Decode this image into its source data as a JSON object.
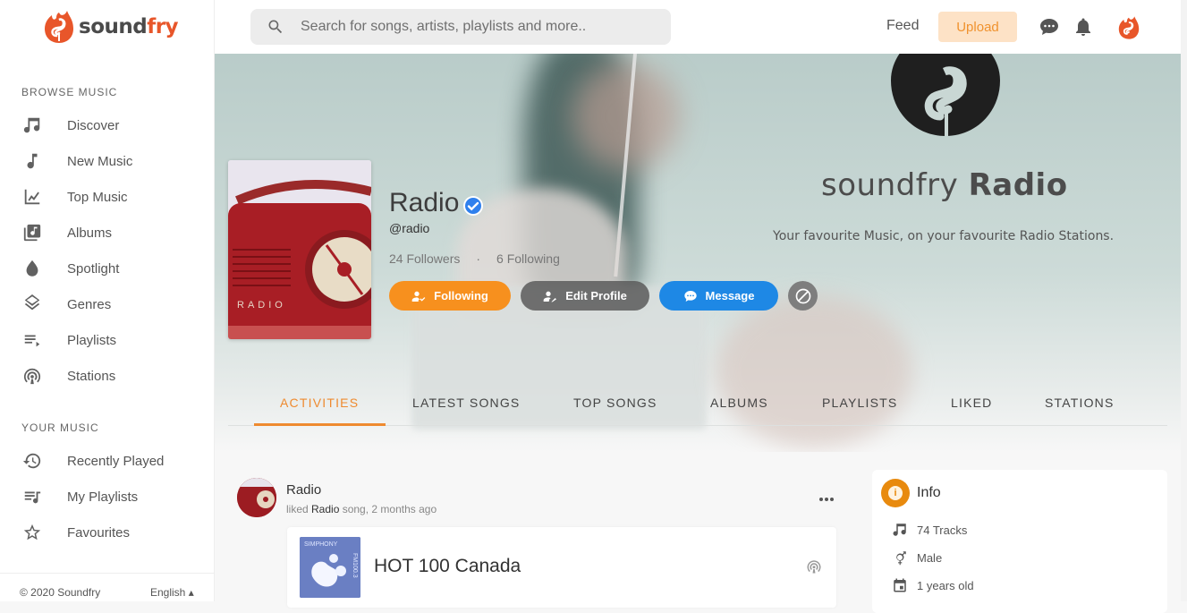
{
  "app": {
    "brand_prefix": "sound",
    "brand_suffix": "fry",
    "brand_color": "#e8562a"
  },
  "sidebar": {
    "browse_title": "BROWSE MUSIC",
    "browse_items": [
      {
        "label": "Discover",
        "icon": "music-notes-icon"
      },
      {
        "label": "New Music",
        "icon": "music-note-icon"
      },
      {
        "label": "Top Music",
        "icon": "trending-chart-icon"
      },
      {
        "label": "Albums",
        "icon": "album-library-icon"
      },
      {
        "label": "Spotlight",
        "icon": "drop-icon"
      },
      {
        "label": "Genres",
        "icon": "layers-icon"
      },
      {
        "label": "Playlists",
        "icon": "playlist-play-icon"
      },
      {
        "label": "Stations",
        "icon": "podcast-antenna-icon"
      }
    ],
    "your_title": "YOUR MUSIC",
    "your_items": [
      {
        "label": "Recently Played",
        "icon": "history-icon"
      },
      {
        "label": "My Playlists",
        "icon": "queue-music-icon"
      },
      {
        "label": "Favourites",
        "icon": "star-outline-icon"
      }
    ],
    "footer": {
      "copyright": "© 2020 Soundfry",
      "language": "English ▴"
    }
  },
  "header": {
    "search_placeholder": "Search for songs, artists, playlists and more..",
    "search_value": "",
    "feed_label": "Feed",
    "upload_label": "Upload",
    "upload_color": "#f0922e"
  },
  "banner": {
    "title_light": "soundfry ",
    "title_bold": "Radio",
    "subtitle": "Your favourite Music, on your favourite Radio Stations."
  },
  "profile": {
    "name": "Radio",
    "verified": true,
    "handle": "@radio",
    "followers": "24 Followers",
    "separator": "·",
    "following": "6 Following",
    "cover_text": "RADIO",
    "buttons": {
      "following": "Following",
      "edit": "Edit Profile",
      "message": "Message"
    },
    "colors": {
      "following": "#f7901e",
      "message": "#1e88e5",
      "verified": "#1e88e5"
    }
  },
  "tabs": [
    {
      "label": "ACTIVITIES",
      "active": true
    },
    {
      "label": "LATEST SONGS",
      "active": false
    },
    {
      "label": "TOP SONGS",
      "active": false
    },
    {
      "label": "ALBUMS",
      "active": false
    },
    {
      "label": "PLAYLISTS",
      "active": false
    },
    {
      "label": "LIKED",
      "active": false
    },
    {
      "label": "STATIONS",
      "active": false
    }
  ],
  "activity": {
    "user": "Radio",
    "action_prefix": "liked ",
    "action_target": "Radio",
    "action_suffix": " song, 2 months ago",
    "track": {
      "title": "HOT 100 Canada",
      "art_top_text": "SIMPHONY",
      "art_side_text": "FM100.3"
    }
  },
  "info": {
    "title": "Info",
    "rows": [
      {
        "icon": "music-notes-icon",
        "text": "74 Tracks"
      },
      {
        "icon": "gender-icon",
        "text": "Male"
      },
      {
        "icon": "calendar-icon",
        "text": "1 years old"
      }
    ]
  }
}
